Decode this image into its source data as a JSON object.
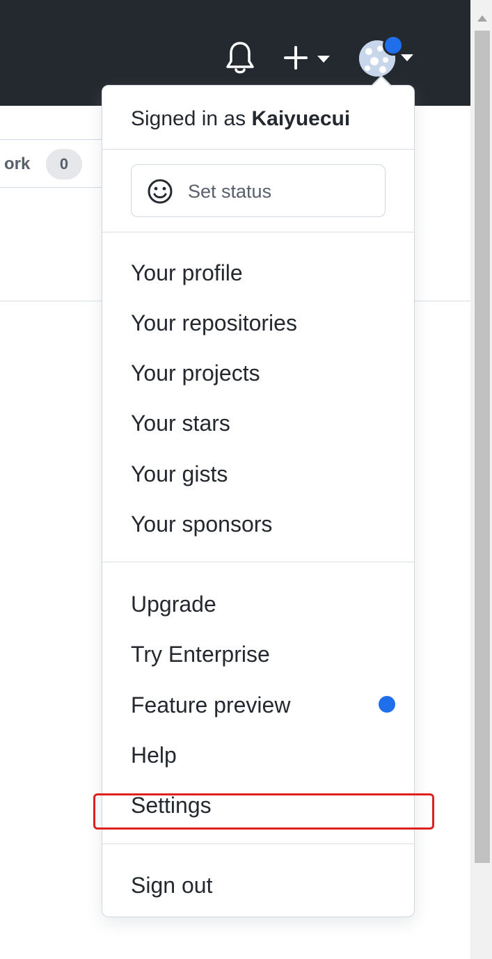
{
  "page": {
    "fork_label": "ork",
    "fork_count": "0"
  },
  "header": {
    "icons": [
      "bell-icon",
      "plus-icon",
      "caret-down-icon",
      "avatar",
      "caret-down-icon"
    ],
    "notification_dot_color": "#1f6feb",
    "background_color": "#24292f"
  },
  "dropdown": {
    "signed_in_prefix": "Signed in as",
    "username": "Kaiyuecui",
    "status_button_label": "Set status",
    "status_icon": "smiley-icon",
    "section1": [
      "Your profile",
      "Your repositories",
      "Your projects",
      "Your stars",
      "Your gists",
      "Your sponsors"
    ],
    "section2": [
      "Upgrade",
      "Try Enterprise",
      "Feature preview",
      "Help",
      "Settings"
    ],
    "section3": [
      "Sign out"
    ],
    "feature_preview_dot_color": "#1f6feb",
    "highlight_color": "#e02020"
  }
}
